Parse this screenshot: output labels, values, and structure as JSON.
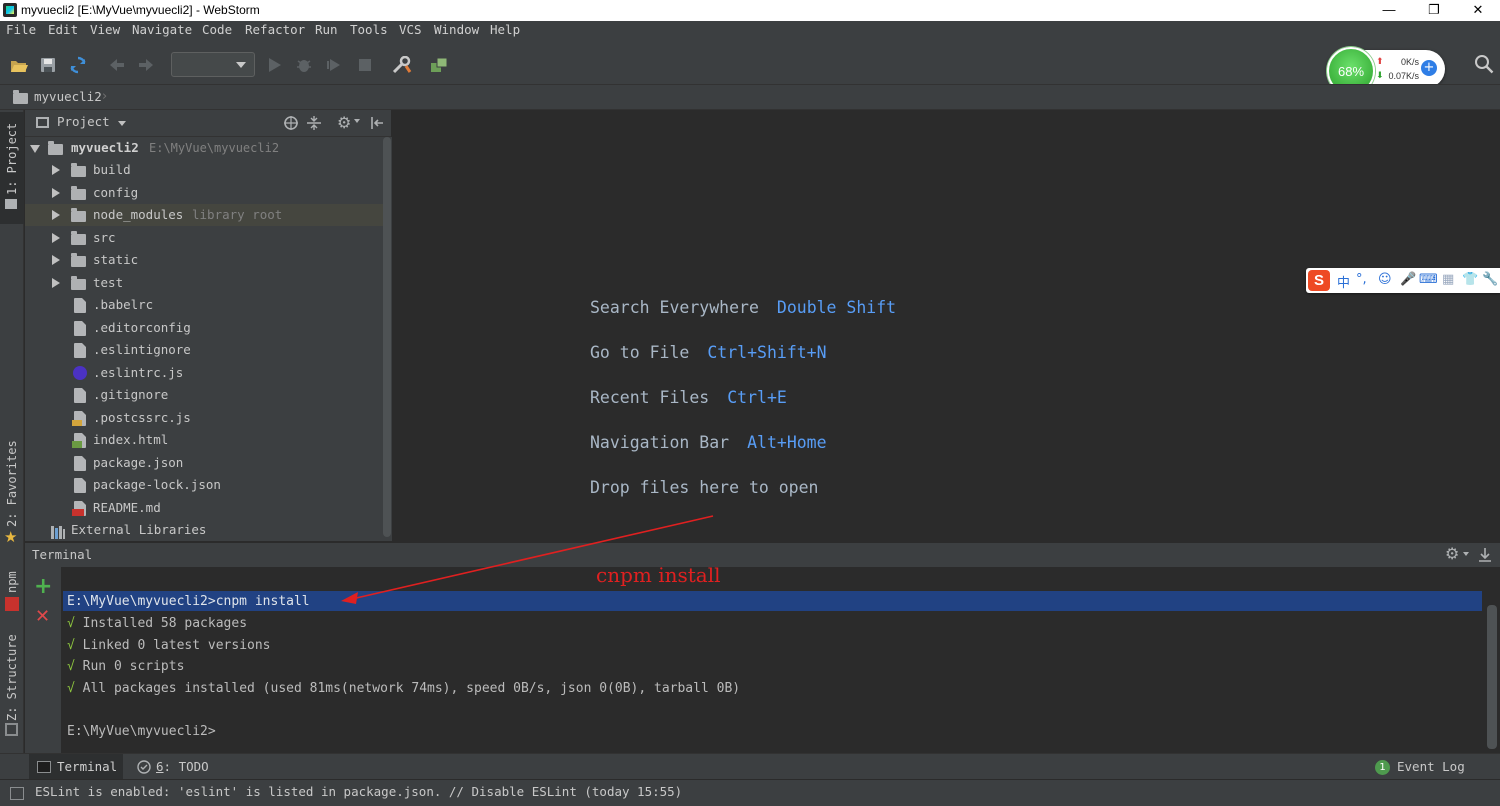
{
  "window": {
    "title": "myvuecli2 [E:\\MyVue\\myvuecli2] - WebStorm",
    "minimize": "—",
    "maximize": "❐",
    "close": "✕"
  },
  "menu": [
    "File",
    "Edit",
    "View",
    "Navigate",
    "Code",
    "Refactor",
    "Run",
    "Tools",
    "VCS",
    "Window",
    "Help"
  ],
  "network_widget": {
    "percent": "68%",
    "upload": "0K/s",
    "download": "0.07K/s"
  },
  "breadcrumb": "myvuecli2",
  "left_tabs": [
    "1: Project",
    "2: Favorites",
    "npm",
    "Z: Structure"
  ],
  "project_panel": {
    "title": "Project",
    "root": {
      "name": "myvuecli2",
      "path": "E:\\MyVue\\myvuecli2"
    },
    "folders": [
      {
        "name": "build",
        "hint": ""
      },
      {
        "name": "config",
        "hint": ""
      },
      {
        "name": "node_modules",
        "hint": "library root"
      },
      {
        "name": "src",
        "hint": ""
      },
      {
        "name": "static",
        "hint": ""
      },
      {
        "name": "test",
        "hint": ""
      }
    ],
    "files": [
      ".babelrc",
      ".editorconfig",
      ".eslintignore",
      ".eslintrc.js",
      ".gitignore",
      ".postcssrc.js",
      "index.html",
      "package.json",
      "package-lock.json",
      "README.md"
    ],
    "external": "External Libraries"
  },
  "editor_hints": [
    {
      "label": "Search Everywhere",
      "key": "Double Shift"
    },
    {
      "label": "Go to File",
      "key": "Ctrl+Shift+N"
    },
    {
      "label": "Recent Files",
      "key": "Ctrl+E"
    },
    {
      "label": "Navigation Bar",
      "key": "Alt+Home"
    },
    {
      "label": "Drop files here to open",
      "key": ""
    }
  ],
  "ime_toolbar": {
    "logo": "S",
    "mode": "中",
    "punct": "°,"
  },
  "terminal": {
    "title": "Terminal",
    "command_line": "E:\\MyVue\\myvuecli2>cnpm install",
    "output": [
      "Installed 58 packages",
      "Linked 0 latest versions",
      "Run 0 scripts",
      "All packages installed (used 81ms(network 74ms), speed 0B/s, json 0(0B), tarball 0B)"
    ],
    "check_mark": "√",
    "prompt": "E:\\MyVue\\myvuecli2>"
  },
  "annotation": "cnpm install",
  "bottom_tabs": {
    "terminal": "Terminal",
    "todo_num": "6",
    "todo_label": ": TODO",
    "event_count": "1",
    "event_log": "Event Log"
  },
  "status_message": "ESLint is enabled: 'eslint' is listed in package.json. // Disable ESLint (today 15:55)"
}
